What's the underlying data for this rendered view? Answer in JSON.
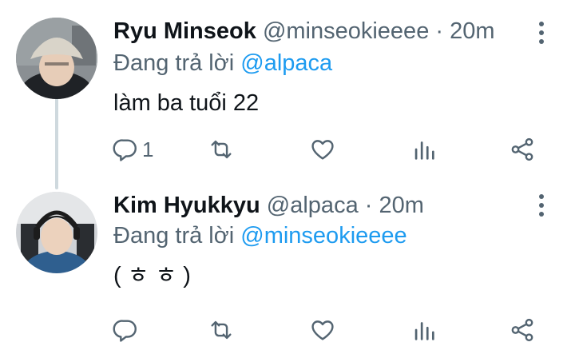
{
  "tweets": [
    {
      "name": "Ryu Minseok",
      "handle": "@minseokieeee",
      "separator": "·",
      "time": "20m",
      "replying_prefix": "Đang trả lời",
      "replying_to": "@alpaca",
      "text": "làm ba tuổi 22",
      "reply_count": "1",
      "retweet_count": "",
      "like_count": ""
    },
    {
      "name": "Kim Hyukkyu",
      "handle": "@alpaca",
      "separator": "·",
      "time": "20m",
      "replying_prefix": "Đang trả lời",
      "replying_to": "@minseokieeee",
      "text": "( ㅎ ㅎ )",
      "reply_count": "",
      "retweet_count": "",
      "like_count": ""
    }
  ],
  "colors": {
    "text": "#0f1419",
    "secondary": "#536471",
    "mention": "#1d9bf0",
    "thread_line": "#cfd9de"
  },
  "icons": [
    "reply-icon",
    "retweet-icon",
    "like-icon",
    "analytics-icon",
    "share-icon",
    "more-icon"
  ]
}
